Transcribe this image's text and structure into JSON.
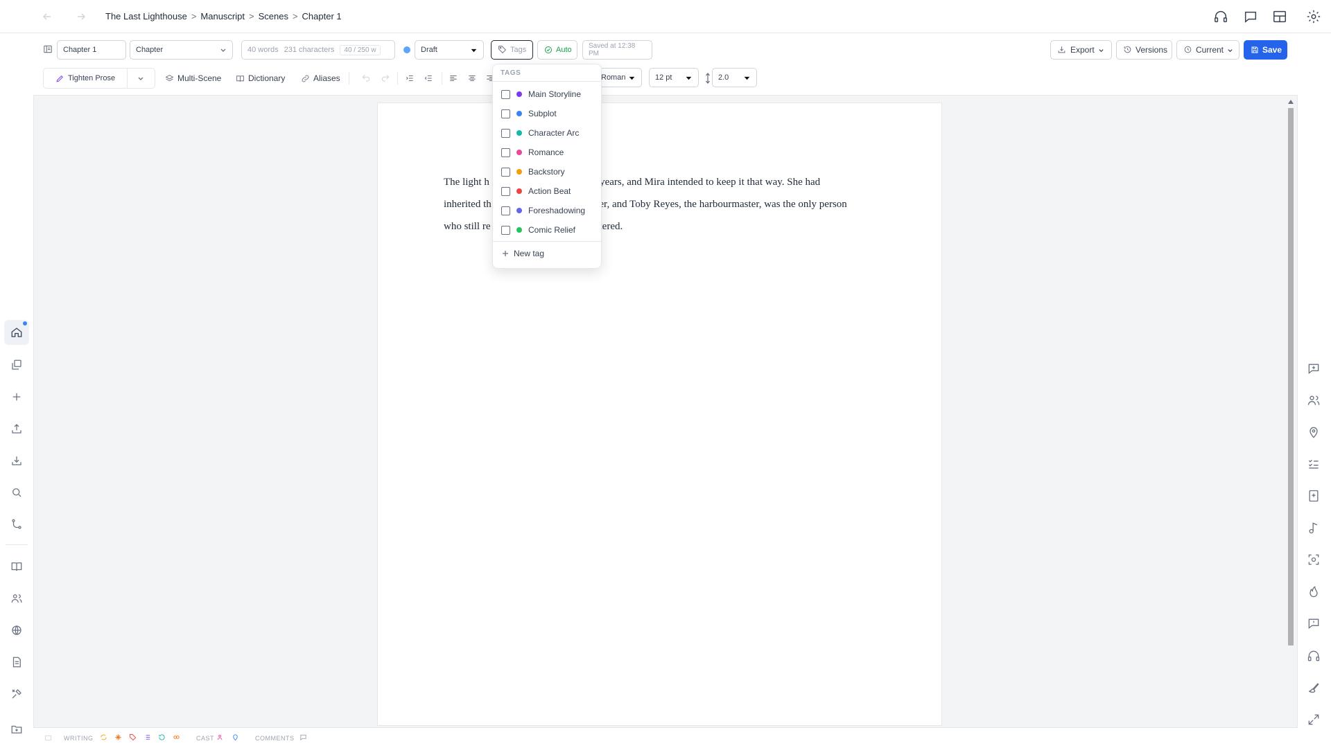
{
  "breadcrumb": [
    "The Last Lighthouse",
    "Manuscript",
    "Scenes",
    "Chapter 1"
  ],
  "breadcrumb_sep": ">",
  "toolbar": {
    "title_value": "Chapter 1",
    "type_value": "Chapter",
    "word_count": "40 words",
    "char_count": "231 characters",
    "goal": "40 / 250 w",
    "status_value": "Draft",
    "status_color": "#60a5fa",
    "tags_label": "Tags",
    "auto_label": "Auto",
    "saved_label": "Saved at 12:38 PM",
    "export_label": "Export",
    "versions_label": "Versions",
    "current_label": "Current",
    "save_label": "Save"
  },
  "format": {
    "tighten_label": "Tighten Prose",
    "multiscene_label": "Multi-Scene",
    "dictionary_label": "Dictionary",
    "aliases_label": "Aliases",
    "font_value": "Roman",
    "size_value": "12 pt",
    "spacing_value": "2.0"
  },
  "document": {
    "line1": "The light h",
    "line1b": "y years, and Mira intended to keep it that way. She had",
    "line2": "inherited th",
    "line2b": "ther, and Toby Reyes, the harbourmaster, was the only person",
    "line3": "who still re",
    "line3b": "tered."
  },
  "tags_dropdown": {
    "header": "TAGS",
    "items": [
      {
        "label": "Main Storyline",
        "color": "#7c3aed",
        "checked": false
      },
      {
        "label": "Subplot",
        "color": "#3b82f6",
        "checked": false
      },
      {
        "label": "Character Arc",
        "color": "#14b8a6",
        "checked": false
      },
      {
        "label": "Romance",
        "color": "#ec4899",
        "checked": false
      },
      {
        "label": "Backstory",
        "color": "#f59e0b",
        "checked": false
      },
      {
        "label": "Action Beat",
        "color": "#ef4444",
        "checked": false
      },
      {
        "label": "Foreshadowing",
        "color": "#6366f1",
        "checked": false
      },
      {
        "label": "Comic Relief",
        "color": "#22c55e",
        "checked": false
      }
    ],
    "new_tag_label": "New tag"
  },
  "statusbar": {
    "writing_label": "WRITING",
    "cast_label": "CAST",
    "comments_label": "COMMENTS"
  },
  "colors": {
    "accent": "#2563eb",
    "auto_green": "#16a34a"
  }
}
